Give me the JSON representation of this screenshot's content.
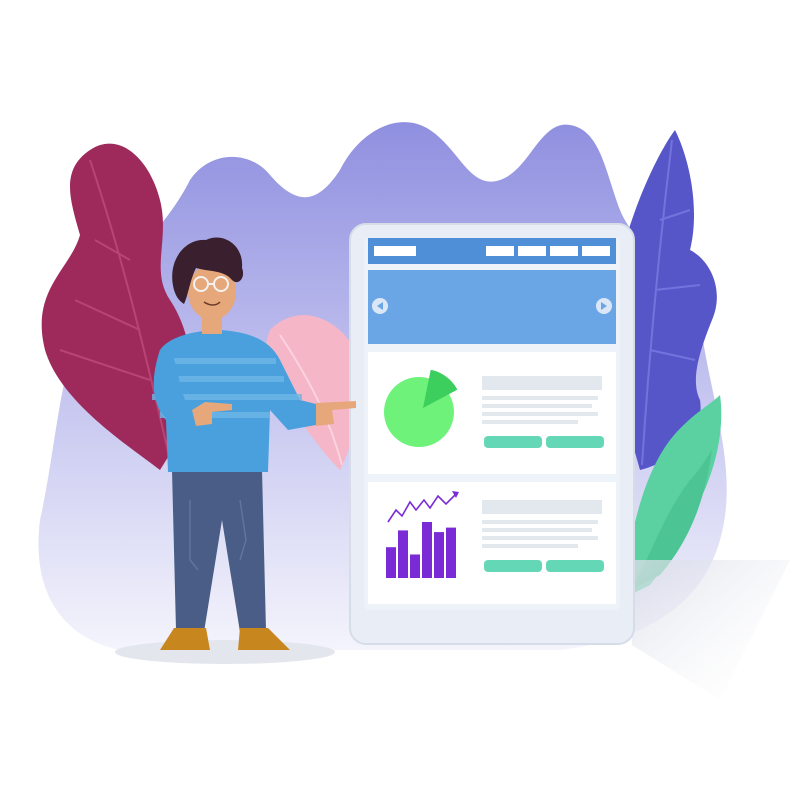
{
  "colors": {
    "background": "#ffffff",
    "blob_top": "#8f8fe0",
    "blob_bottom": "#eeeefb",
    "leaf_magenta": "#9e2a5c",
    "leaf_pink": "#f5b6c8",
    "leaf_blue": "#5656c9",
    "leaf_green": "#5bd1a1",
    "tablet_frame": "#e9eef6",
    "tablet_screen": "#eef2f9",
    "nav_bar": "#4f8fd8",
    "hero_banner": "#6aa6e6",
    "card_bg": "#ffffff",
    "text_placeholder": "#e3e8ef",
    "button_green": "#64d8b6",
    "pie_main": "#6ef27a",
    "pie_slice": "#3ccf5e",
    "bar_purple": "#7a2bd6",
    "shirt": "#4aa0dc",
    "shirt_stripe": "#6fb7e8",
    "pants": "#4a5d86",
    "skin": "#e6a77a",
    "hair": "#3a1f2e",
    "shoes": "#c8861f"
  },
  "icons": {
    "carousel_prev": "chevron-left-icon",
    "carousel_next": "chevron-right-icon",
    "pie_chart": "pie-chart-icon",
    "bar_chart": "bar-chart-icon",
    "trend_arrow": "trend-arrow-icon"
  },
  "tablet": {
    "nav_items_count": 4,
    "carousel_buttons": [
      "prev",
      "next"
    ],
    "card_buttons_per_card": 2
  },
  "bar_widget": {
    "values": [
      0.55,
      0.85,
      0.42,
      1.0,
      0.82,
      0.9
    ]
  },
  "pie_widget": {
    "slice_fraction": 0.14
  }
}
